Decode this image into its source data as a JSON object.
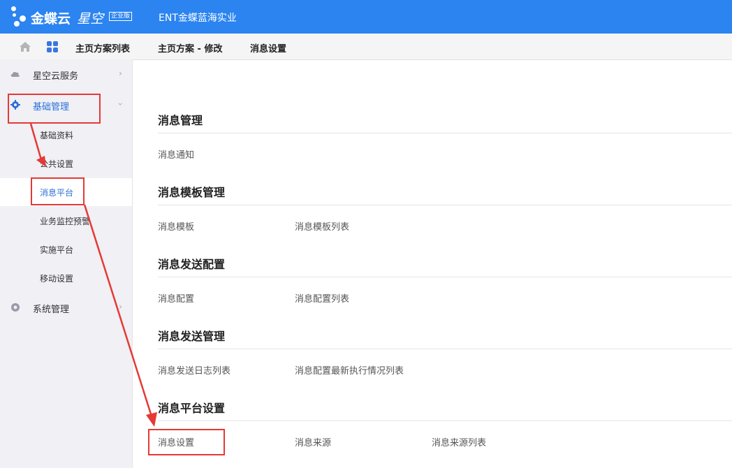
{
  "header": {
    "logo_main": "金蝶云",
    "logo_sub": "星空",
    "logo_badge": "企业版",
    "company": "ENT金蝶蓝海实业"
  },
  "tabs": [
    {
      "label": "主页方案列表"
    },
    {
      "label": "主页方案 - 修改"
    },
    {
      "label": "消息设置"
    }
  ],
  "sidebar": {
    "groups": [
      {
        "label": "星空云服务",
        "icon": "cloud-icon",
        "expanded": false
      },
      {
        "label": "基础管理",
        "icon": "gear-icon",
        "expanded": true
      },
      {
        "label": "系统管理",
        "icon": "settings-circle-icon",
        "expanded": false
      }
    ],
    "items": [
      {
        "label": "基础资料"
      },
      {
        "label": "公共设置"
      },
      {
        "label": "消息平台",
        "active": true
      },
      {
        "label": "业务监控预警"
      },
      {
        "label": "实施平台"
      },
      {
        "label": "移动设置"
      }
    ]
  },
  "sections": [
    {
      "title": "消息管理",
      "links": [
        "消息通知"
      ]
    },
    {
      "title": "消息模板管理",
      "links": [
        "消息模板",
        "消息模板列表"
      ]
    },
    {
      "title": "消息发送配置",
      "links": [
        "消息配置",
        "消息配置列表"
      ]
    },
    {
      "title": "消息发送管理",
      "links": [
        "消息发送日志列表",
        "消息配置最新执行情况列表"
      ]
    },
    {
      "title": "消息平台设置",
      "links": [
        "消息设置",
        "消息来源",
        "消息来源列表"
      ]
    }
  ],
  "colors": {
    "topbar": "#2b84f0",
    "active_text": "#2b6fd8",
    "annotation": "#e53935"
  }
}
